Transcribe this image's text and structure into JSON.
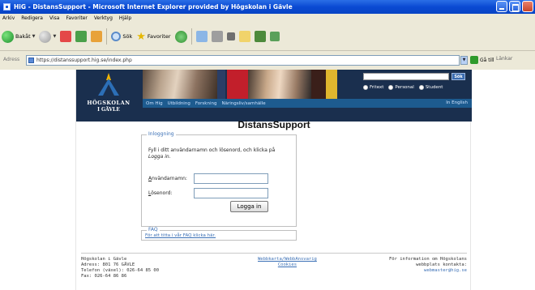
{
  "window": {
    "title": "HiG - DistansSupport - Microsoft Internet Explorer provided by Högskolan i Gävle"
  },
  "menu": [
    "Arkiv",
    "Redigera",
    "Visa",
    "Favoriter",
    "Verktyg",
    "Hjälp"
  ],
  "toolbar": {
    "back_label": "Bakåt",
    "search_label": "Sök",
    "favorites_label": "Favoriter"
  },
  "address": {
    "label": "Adress",
    "url": "https://distanssupport.hig.se/index.php",
    "go_label": "Gå till",
    "links_label": "Länkar"
  },
  "site": {
    "logo_line1": "HÖGSKOLAN",
    "logo_line2": "I GÄVLE",
    "search_button": "Sök",
    "radios": [
      "Fritext",
      "Personal",
      "Student"
    ],
    "nav": [
      "Om Hig",
      "Utbildning",
      "Forskning",
      "Näringsliv/samhälle"
    ],
    "nav_english": "In English",
    "title": "DistansSupport",
    "login": {
      "legend": "Inloggning",
      "intro_pre": "Fyll i ditt användarnamn och lösenord, och klicka på ",
      "intro_em": "Logga in",
      "intro_post": ".",
      "username_label_u": "A",
      "username_label_rest": "nvändarnamn:",
      "password_label_u": "L",
      "password_label_rest": "ösenord:",
      "username_value": "",
      "password_value": "",
      "submit_label": "Logga in"
    },
    "faq": {
      "legend": "FAQ",
      "link_text": "För att titta i vår FAQ klicka här."
    },
    "footer": {
      "left": [
        "Högskolan i Gävle",
        "Adress: 801 76 GÄVLE",
        "Telefon (växel): 026-64 85 00",
        "Fax: 026-64 86 86"
      ],
      "mid": [
        "Webbkarta/WebbAnsvarig",
        "Cookies"
      ],
      "right_line1": "För information om Högskolans",
      "right_line2": "webbplats kontakta:",
      "right_mail": "webmaster@hig.se"
    }
  }
}
